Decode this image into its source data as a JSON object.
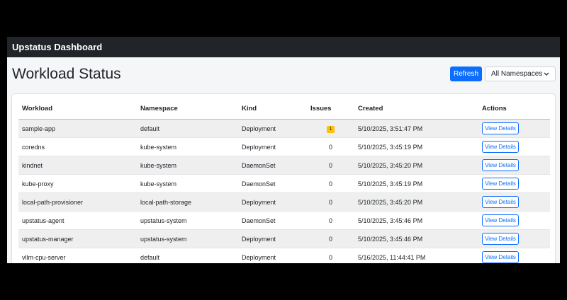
{
  "navbar": {
    "title": "Upstatus Dashboard"
  },
  "page": {
    "title": "Workload Status"
  },
  "controls": {
    "refresh_label": "Refresh",
    "namespace_selected": "All Namespaces"
  },
  "table": {
    "headers": {
      "workload": "Workload",
      "namespace": "Namespace",
      "kind": "Kind",
      "issues": "Issues",
      "created": "Created",
      "actions": "Actions"
    },
    "action_label": "View Details",
    "rows": [
      {
        "workload": "sample-app",
        "namespace": "default",
        "kind": "Deployment",
        "issues": "1",
        "issues_badge": true,
        "created": "5/10/2025, 3:51:47 PM"
      },
      {
        "workload": "coredns",
        "namespace": "kube-system",
        "kind": "Deployment",
        "issues": "0",
        "issues_badge": false,
        "created": "5/10/2025, 3:45:19 PM"
      },
      {
        "workload": "kindnet",
        "namespace": "kube-system",
        "kind": "DaemonSet",
        "issues": "0",
        "issues_badge": false,
        "created": "5/10/2025, 3:45:20 PM"
      },
      {
        "workload": "kube-proxy",
        "namespace": "kube-system",
        "kind": "DaemonSet",
        "issues": "0",
        "issues_badge": false,
        "created": "5/10/2025, 3:45:19 PM"
      },
      {
        "workload": "local-path-provisioner",
        "namespace": "local-path-storage",
        "kind": "Deployment",
        "issues": "0",
        "issues_badge": false,
        "created": "5/10/2025, 3:45:20 PM"
      },
      {
        "workload": "upstatus-agent",
        "namespace": "upstatus-system",
        "kind": "DaemonSet",
        "issues": "0",
        "issues_badge": false,
        "created": "5/10/2025, 3:45:46 PM"
      },
      {
        "workload": "upstatus-manager",
        "namespace": "upstatus-system",
        "kind": "Deployment",
        "issues": "0",
        "issues_badge": false,
        "created": "5/10/2025, 3:45:46 PM"
      },
      {
        "workload": "vllm-cpu-server",
        "namespace": "default",
        "kind": "Deployment",
        "issues": "0",
        "issues_badge": false,
        "created": "5/16/2025, 11:44:41 PM"
      }
    ]
  },
  "colors": {
    "navbar_bg": "#212529",
    "primary": "#0d6efd",
    "warning_badge": "#ffc107",
    "page_bg": "#f5f6f8"
  },
  "icons": {
    "select_chevron": "chevron-down-icon"
  }
}
